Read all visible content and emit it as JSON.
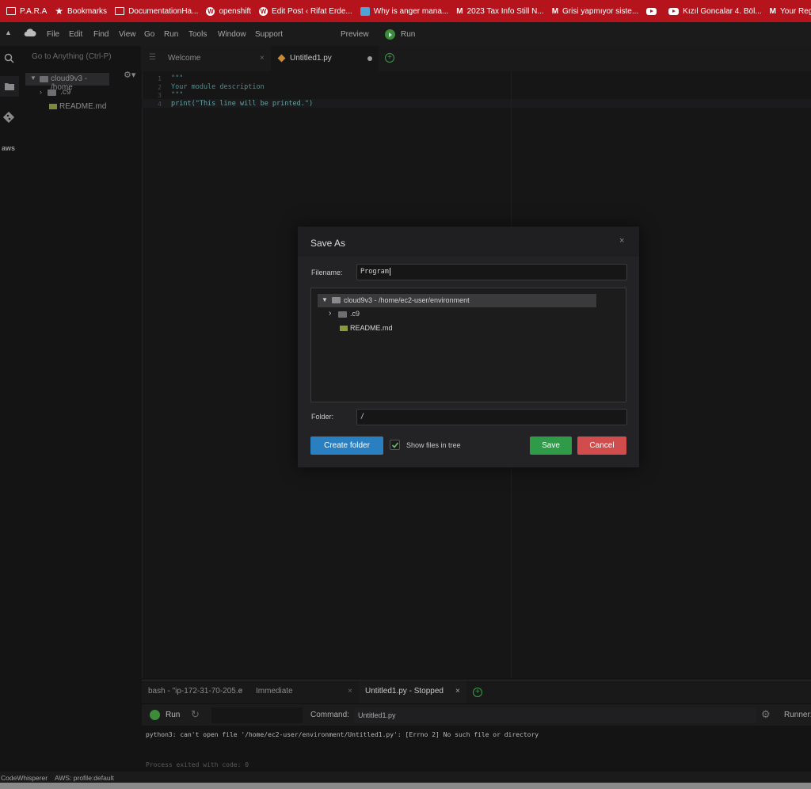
{
  "bookmarks": [
    {
      "label": "P.A.R.A",
      "icon": "folder-icon"
    },
    {
      "label": "Bookmarks",
      "icon": "star-icon"
    },
    {
      "label": "DocumentationHa...",
      "icon": "folder-icon"
    },
    {
      "label": "openshift",
      "icon": "wordpress-icon"
    },
    {
      "label": "Edit Post ‹ Rifat Erde...",
      "icon": "wordpress-icon"
    },
    {
      "label": "Why is anger mana...",
      "icon": "heart-icon"
    },
    {
      "label": "2023 Tax Info Still N...",
      "icon": "gmail-icon"
    },
    {
      "label": "Grisi yapmıyor siste...",
      "icon": "gmail-icon"
    },
    {
      "label": "",
      "icon": "youtube-icon"
    },
    {
      "label": "Kızıl Goncalar 4. Böl...",
      "icon": "youtube-icon"
    },
    {
      "label": "Your Register.com...",
      "icon": "gmail-icon"
    }
  ],
  "menu": {
    "items": [
      "File",
      "Edit",
      "Find",
      "View",
      "Go",
      "Run",
      "Tools",
      "Window",
      "Support"
    ],
    "preview": "Preview",
    "run": "Run"
  },
  "tree": {
    "goto_placeholder": "Go to Anything (Ctrl-P)",
    "root": "cloud9v3 - /home",
    "children": [
      ".c9",
      "README.md"
    ]
  },
  "tabs": [
    {
      "label": "Welcome"
    },
    {
      "label": "Untitled1.py"
    }
  ],
  "code": {
    "lines": [
      "\"\"\"",
      "Your module description",
      "\"\"\"",
      "print(\"This line will be printed.\")"
    ],
    "numbers": [
      "1",
      "2",
      "3",
      "4"
    ]
  },
  "dialog": {
    "title": "Save As",
    "filename_label": "Filename:",
    "filename_value": "Program",
    "tree_root": "cloud9v3 - /home/ec2-user/environment",
    "tree_children": [
      ".c9",
      "README.md"
    ],
    "folder_label": "Folder:",
    "folder_value": "/",
    "create_folder": "Create folder",
    "show_files": "Show files in tree",
    "save": "Save",
    "cancel": "Cancel"
  },
  "bottom": {
    "tabs": [
      "bash - \"ip-172-31-70-205.e",
      "Immediate",
      "Untitled1.py - Stopped"
    ],
    "run": "Run",
    "command_label": "Command:",
    "command_value": "Untitled1.py",
    "runner": "Runner:",
    "output": "python3: can't open file '/home/ec2-user/environment/Untitled1.py': [Errno 2] No such file or directory",
    "exit": "Process exited with code: 0"
  },
  "status": {
    "codewhisperer": "CodeWhisperer",
    "aws": "AWS: profile:default"
  },
  "colors": {
    "accent_blue": "#2a7fc1",
    "save_green": "#2f9b48",
    "cancel_red": "#d14c4c",
    "bookmark_bar": "#b5141d"
  }
}
